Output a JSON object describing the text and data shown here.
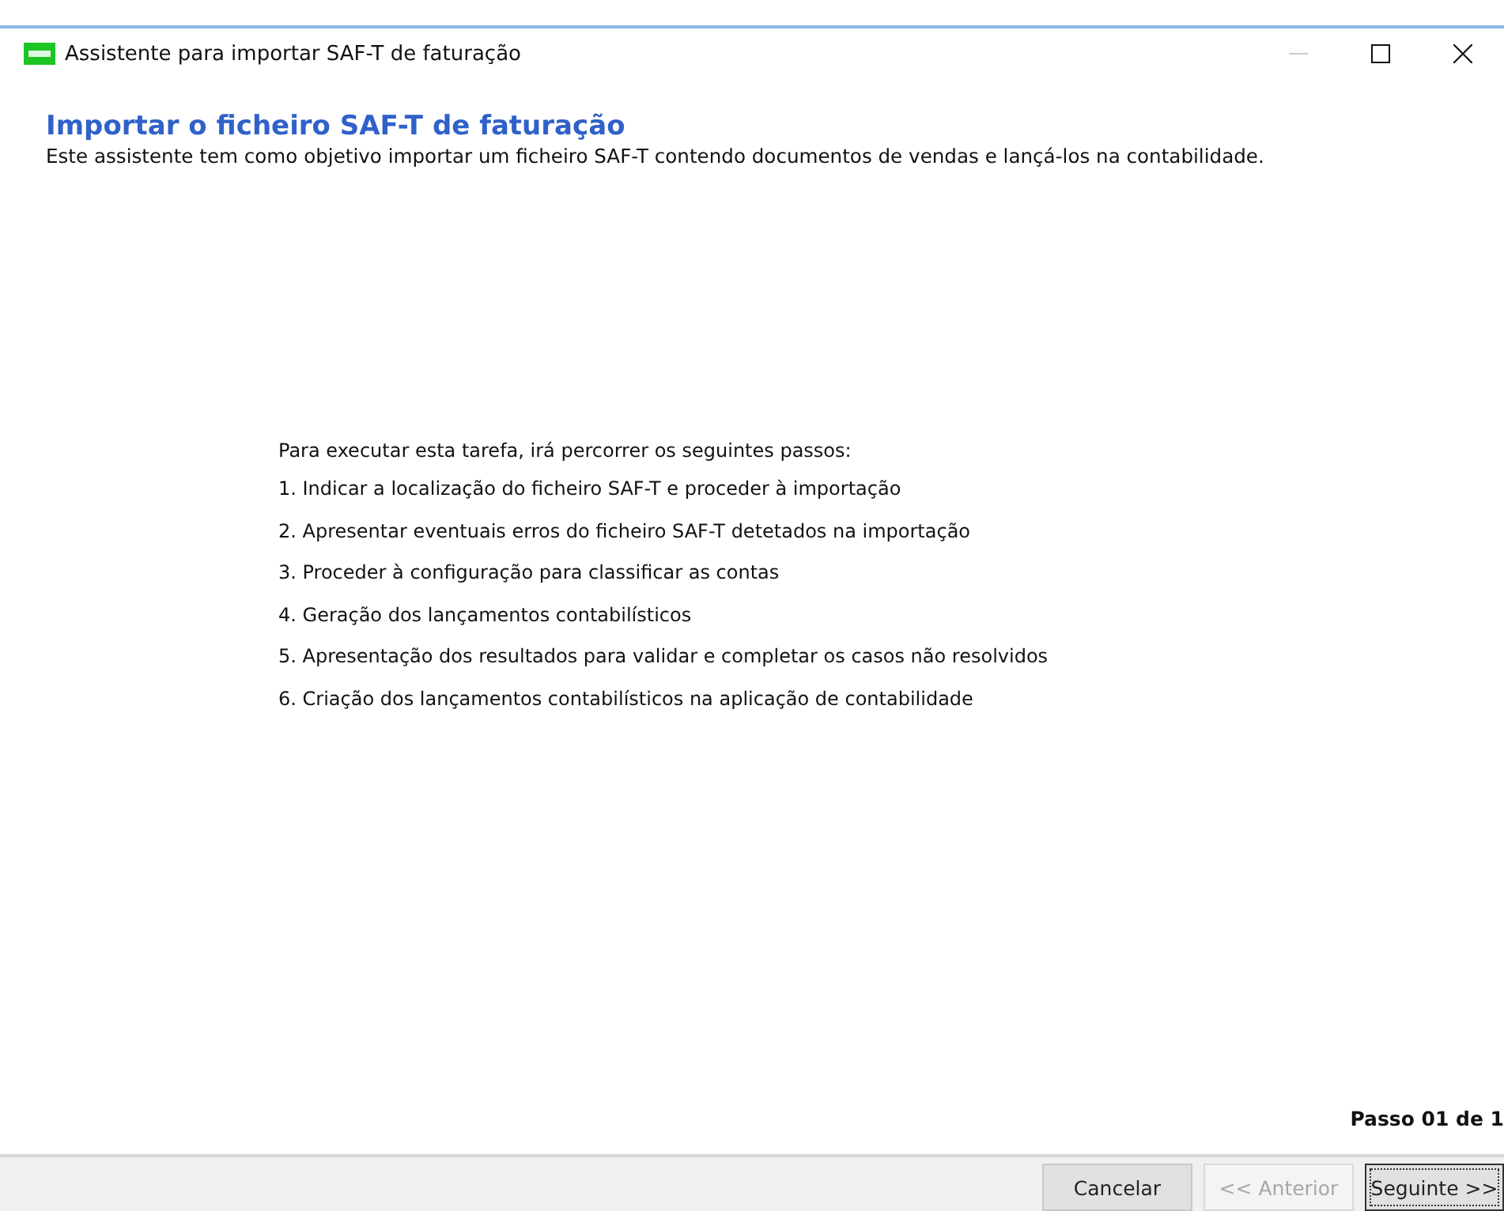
{
  "window": {
    "title": "Assistente para importar SAF-T de faturação",
    "controls": [
      {
        "kind": "minimize",
        "disabled": true
      },
      {
        "kind": "maximize",
        "disabled": false
      },
      {
        "kind": "close",
        "disabled": false
      }
    ]
  },
  "header": {
    "title": "Importar o ficheiro SAF-T de faturação",
    "subtitle": "Este assistente tem como objetivo importar um ficheiro SAF-T contendo documentos de vendas e lançá-los na contabilidade."
  },
  "intro": "Para executar esta tarefa, irá percorrer os seguintes passos:",
  "steps": [
    "1. Indicar a localização do ficheiro SAF-T e proceder à importação",
    "2. Apresentar eventuais erros do ficheiro SAF-T detetados na importação",
    "3. Proceder à configuração para classificar as contas",
    "4. Geração dos lançamentos contabilísticos",
    "5. Apresentação dos resultados para validar e completar os casos não resolvidos",
    "6. Criação dos lançamentos contabilísticos na aplicação de contabilidade"
  ],
  "step_counter": "Passo 01 de 1",
  "buttons": [
    {
      "label": "Cancelar",
      "disabled": false,
      "focused": false
    },
    {
      "label": "<< Anterior",
      "disabled": true,
      "focused": false
    },
    {
      "label": "Seguinte >>",
      "disabled": false,
      "focused": true
    }
  ]
}
